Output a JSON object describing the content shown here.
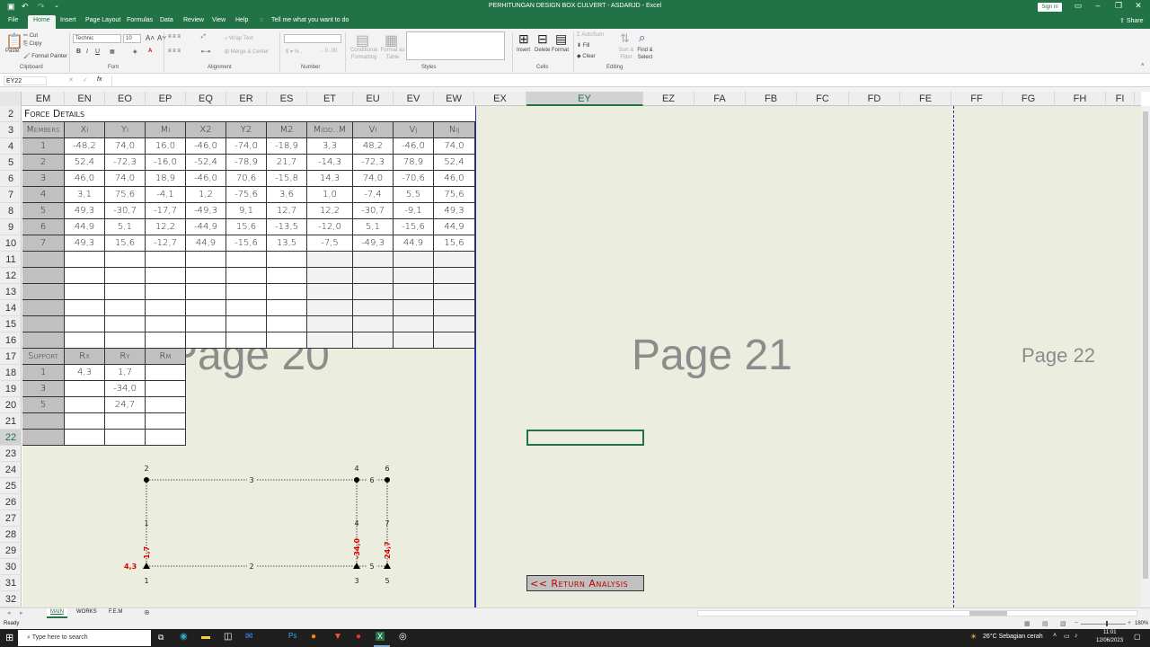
{
  "app": {
    "title": "PERHITUNGAN DESIGN BOX CULVERT - ASDARJD  -  Excel",
    "signin": "Sign in"
  },
  "tabs": [
    "File",
    "Home",
    "Insert",
    "Page Layout",
    "Formulas",
    "Data",
    "Review",
    "View",
    "Help",
    "Tell me what you want to do"
  ],
  "share": "Share",
  "ribbon": {
    "paste": "Paste",
    "cut": "Cut",
    "copy": "Copy",
    "format_painter": "Format Painter",
    "clipboard": "Clipboard",
    "font_name": "Technic",
    "font_size": "10",
    "font": "Font",
    "wrap_text": "Wrap Text",
    "merge_center": "Merge & Center",
    "alignment": "Alignment",
    "number": "Number",
    "cond_fmt": "Conditional Formatting",
    "fmt_table": "Format as Table",
    "styles": "Styles",
    "insert": "Insert",
    "delete": "Delete",
    "format": "Format",
    "cells": "Cells",
    "autosum": "AutoSum",
    "fill": "Fill",
    "clear": "Clear",
    "sort_filter": "Sort & Filter",
    "find_select": "Find & Select",
    "editing": "Editing"
  },
  "formula_bar": {
    "name_box": "EY22",
    "fx": "fx",
    "value": ""
  },
  "columns": [
    {
      "l": "EM",
      "w": 47
    },
    {
      "l": "EN",
      "w": 45
    },
    {
      "l": "EO",
      "w": 45
    },
    {
      "l": "EP",
      "w": 45
    },
    {
      "l": "EQ",
      "w": 45
    },
    {
      "l": "ER",
      "w": 45
    },
    {
      "l": "ES",
      "w": 45
    },
    {
      "l": "ET",
      "w": 51
    },
    {
      "l": "EU",
      "w": 45
    },
    {
      "l": "EV",
      "w": 45
    },
    {
      "l": "EW",
      "w": 45
    },
    {
      "l": "EX",
      "w": 58
    },
    {
      "l": "EY",
      "w": 130
    },
    {
      "l": "EZ",
      "w": 57
    },
    {
      "l": "FA",
      "w": 57
    },
    {
      "l": "FB",
      "w": 57
    },
    {
      "l": "FC",
      "w": 58
    },
    {
      "l": "FD",
      "w": 57
    },
    {
      "l": "FE",
      "w": 57
    },
    {
      "l": "FF",
      "w": 57
    },
    {
      "l": "FG",
      "w": 58
    },
    {
      "l": "FH",
      "w": 57
    },
    {
      "l": "FI",
      "w": 32
    }
  ],
  "rows": [
    "2",
    "3",
    "4",
    "5",
    "6",
    "7",
    "8",
    "9",
    "10",
    "11",
    "12",
    "13",
    "14",
    "15",
    "16",
    "17",
    "18",
    "19",
    "20",
    "21",
    "22",
    "23",
    "24",
    "25",
    "26",
    "27",
    "28",
    "29",
    "30",
    "31",
    "32"
  ],
  "force": {
    "title": "Force Details",
    "headers": [
      "Members",
      "Xi",
      "Yi",
      "Mi",
      "X2",
      "Y2",
      "M2",
      "Midd..M",
      "Vi",
      "Vj",
      "Nij"
    ],
    "rows": [
      [
        "1",
        "-48,2",
        "74,0",
        "16,0",
        "-46,0",
        "-74,0",
        "-18,9",
        "3,3",
        "48,2",
        "-46,0",
        "74,0"
      ],
      [
        "2",
        "52,4",
        "-72,3",
        "-16,0",
        "-52,4",
        "-78,9",
        "21,7",
        "-14,3",
        "-72,3",
        "78,9",
        "52,4"
      ],
      [
        "3",
        "46,0",
        "74,0",
        "18,9",
        "-46,0",
        "70,6",
        "-15,8",
        "14,3",
        "74,0",
        "-70,6",
        "46,0"
      ],
      [
        "4",
        "3,1",
        "75,6",
        "-4,1",
        "1,2",
        "-75,6",
        "3,6",
        "1,0",
        "-7,4",
        "5,5",
        "75,6"
      ],
      [
        "5",
        "49,3",
        "-30,7",
        "-17,7",
        "-49,3",
        "9,1",
        "12,7",
        "12,2",
        "-30,7",
        "-9,1",
        "49,3"
      ],
      [
        "6",
        "44,9",
        "5,1",
        "12,2",
        "-44,9",
        "15,6",
        "-13,5",
        "-12,0",
        "5,1",
        "-15,6",
        "44,9"
      ],
      [
        "7",
        "49,3",
        "15,6",
        "-12,7",
        "44,9",
        "-15,6",
        "13,5",
        "-7,5",
        "-49,3",
        "44,9",
        "15,6"
      ]
    ]
  },
  "support": {
    "headers": [
      "Support",
      "Rx",
      "Ry",
      "Rm"
    ],
    "rows": [
      [
        "1",
        "4,3",
        "1,7",
        ""
      ],
      [
        "3",
        "",
        "-34,0",
        ""
      ],
      [
        "5",
        "",
        "24,7",
        ""
      ]
    ]
  },
  "pages": [
    "Page 20",
    "Page 21",
    "Page 22"
  ],
  "return_button": "<< Return Analysis",
  "diagram": {
    "nodes_top": [
      "2",
      "4",
      "6"
    ],
    "member_top": [
      "3",
      "6"
    ],
    "members_vertical": [
      "1",
      "4",
      "7"
    ],
    "member_bottom": [
      "2",
      "5"
    ],
    "nodes_bottom": [
      "1",
      "3",
      "5"
    ],
    "reactions": [
      "4,3",
      "1,7",
      "-34,0",
      "24,7"
    ]
  },
  "sheets": [
    "MAIN",
    "WORKS",
    "F.E.M"
  ],
  "status": {
    "ready": "Ready",
    "zoom": "180%"
  },
  "taskbar": {
    "search": "Type here to search",
    "weather": "26°C  Sebagian cerah",
    "time": "11:01",
    "date": "12/06/2023"
  },
  "colors": {
    "excel_green": "#217346",
    "sheet_bg": "#ebeedf",
    "header_gray": "#c0c0c0",
    "red": "#e00000",
    "page_label": "#8c8c8c"
  }
}
